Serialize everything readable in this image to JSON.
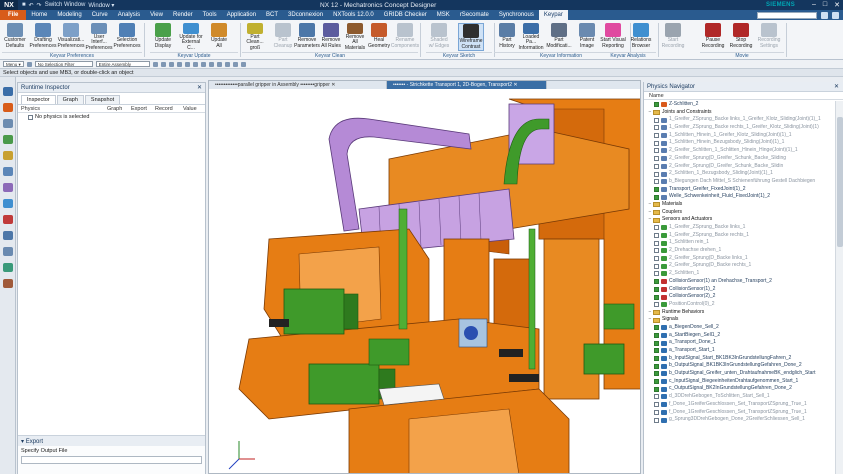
{
  "window": {
    "logo": "NX",
    "title": "NX 12 - Mechatronics Concept Designer",
    "brand": "SIEMENS",
    "quick_access": [
      "Switch Window",
      "Window ▾"
    ],
    "controls": [
      "–",
      "□",
      "✕"
    ]
  },
  "menu": {
    "tabs": [
      "File",
      "Home",
      "Modeling",
      "Curve",
      "Analysis",
      "View",
      "Render",
      "Tools",
      "Application",
      "BCT",
      "3Dconnexion",
      "NXTools 12.0.0",
      "GRIDB Checker",
      "MSK",
      "rSecomate",
      "Synchronous",
      "Keypar"
    ],
    "active": "Keypar"
  },
  "ribbon": {
    "buttons": [
      {
        "label": "Customer\nDefaults",
        "color": "#6d8fb5",
        "state": "normal"
      },
      {
        "label": "Drafting\nPreferences",
        "color": "#5b86b8",
        "state": "normal"
      },
      {
        "label": "Visualizati...\nPreferences",
        "color": "#7da0c8",
        "state": "normal"
      },
      {
        "label": "User Interf...\nPreferences",
        "color": "#6b8fb8",
        "state": "normal"
      },
      {
        "label": "Selection\nPreferences",
        "color": "#4f7fb5",
        "state": "normal"
      },
      {
        "label": "Update\nDisplay",
        "color": "#4aa04a",
        "state": "normal"
      },
      {
        "label": "Update for\nExternal C...",
        "color": "#3f8fd0",
        "state": "normal"
      },
      {
        "label": "Update\nAll",
        "color": "#d08a2a",
        "state": "normal"
      },
      {
        "label": "Part Clean...\ngroß",
        "color": "#c0b030",
        "state": "normal"
      },
      {
        "label": "Part\nCleanup",
        "color": "#b9c3ce",
        "state": "dis"
      },
      {
        "label": "Remove\nParameters",
        "color": "#4d77a8",
        "state": "normal"
      },
      {
        "label": "Remove\nAll Rules",
        "color": "#5c5c9e",
        "state": "normal"
      },
      {
        "label": "Remove\nAll Materials",
        "color": "#8d5a2e",
        "state": "normal"
      },
      {
        "label": "Heal\nGeometry",
        "color": "#c55a2a",
        "state": "normal"
      },
      {
        "label": "Rename\nComponents",
        "color": "#b9c3ce",
        "state": "dis"
      },
      {
        "label": "Shaded\nw/ Edges",
        "color": "#b9c3ce",
        "state": "dis"
      },
      {
        "label": "Wireframe\nContrast",
        "color": "#2f2f2f",
        "state": "sel"
      },
      {
        "label": "Part\nHistory",
        "color": "#5a7da6",
        "state": "normal"
      },
      {
        "label": "Loaded Pa...\nInformation",
        "color": "#3b6ea8",
        "state": "normal"
      },
      {
        "label": "Part\nModificati...",
        "color": "#5f6f86",
        "state": "normal"
      },
      {
        "label": "Patent\nImage",
        "color": "#6a8ab0",
        "state": "normal"
      },
      {
        "label": "Start Visual\nReporting",
        "color": "#e04aa0",
        "state": "normal"
      },
      {
        "label": "Relations\nBrowser",
        "color": "#3f8fd0",
        "state": "normal"
      },
      {
        "label": "Start\nRecording",
        "color": "#9aa4af",
        "state": "dis"
      },
      {
        "label": "Pause\nRecording",
        "color": "#b02828",
        "state": "normal"
      },
      {
        "label": "Stop\nRecording",
        "color": "#b02828",
        "state": "normal"
      },
      {
        "label": "Recording\nSettings",
        "color": "#b9c3ce",
        "state": "dis"
      }
    ],
    "groups": [
      "Keyvar Preferences",
      "Keyvar Update",
      "Keyvar Clean",
      "Keyvar Sketch",
      "Keyvar Information",
      "Keyvar Analysis",
      "Movie"
    ]
  },
  "toolbar2": {
    "menu_label": "Menu ▾",
    "filter": "No Selection Filter",
    "scope": "Entire Assembly"
  },
  "status_line": "Select objects and use MB3, or double-click an object",
  "inspector": {
    "title": "Runtime Inspector",
    "tabs": [
      "Inspector",
      "Graph",
      "Snapshot"
    ],
    "columns": [
      "Physics",
      "Graph",
      "Export",
      "Record",
      "Value"
    ],
    "empty_row": "No physics is selected",
    "export_title": "Export",
    "export_label": "Specify Output File"
  },
  "graphics": {
    "tabs": [
      "•••••••••••••parallel gripper in Assembly ••••••••gripper ✕",
      "••••••• - Strichkette Transport 1, 2D-Bogen, Transport2 ✕"
    ]
  },
  "navigator": {
    "title": "Physics Navigator",
    "column": "Name",
    "rows": [
      {
        "indent": 1,
        "type": "item",
        "check": true,
        "icon": "#d95a1c",
        "text": "Z-Schlitten_2",
        "tone": "normal"
      },
      {
        "indent": 0,
        "type": "folder",
        "text": "Joints and Constraints",
        "tone": "strong"
      },
      {
        "indent": 1,
        "type": "item",
        "check": false,
        "icon": "#5a7db0",
        "text": "1_Greifer_ZSprung_Backe links_1_Greifer_Klotz_Sliding(Joint)(1)_1",
        "tone": "grey"
      },
      {
        "indent": 1,
        "type": "item",
        "check": false,
        "icon": "#5a7db0",
        "text": "1_Greifer_ZSprung_Backe rechts_1_Greifer_Klotz_Sliding(Joint)(1)",
        "tone": "grey"
      },
      {
        "indent": 1,
        "type": "item",
        "check": false,
        "icon": "#5a7db0",
        "text": "1_Schlitten_Hinein_1_Greifer_Klotz_Sliding(Joint)(1)_1",
        "tone": "grey"
      },
      {
        "indent": 1,
        "type": "item",
        "check": false,
        "icon": "#5a7db0",
        "text": "1_Schlitten_Hinein_Bezugsbody_Sliding(Joint)(1)_1",
        "tone": "grey"
      },
      {
        "indent": 1,
        "type": "item",
        "check": false,
        "icon": "#5a7db0",
        "text": "2_Greifer_Schlitten_1_Schlitten_Hinein_Hinge(Joint)(1)_1",
        "tone": "grey"
      },
      {
        "indent": 1,
        "type": "item",
        "check": false,
        "icon": "#5a7db0",
        "text": "2_Greifer_Sprung(D_Greifer_Schunk_Backe_Sliding",
        "tone": "grey"
      },
      {
        "indent": 1,
        "type": "item",
        "check": false,
        "icon": "#5a7db0",
        "text": "2_Greifer_Sprung(D_Greifer_Schunk_Backe_Slidin",
        "tone": "grey"
      },
      {
        "indent": 1,
        "type": "item",
        "check": false,
        "icon": "#5a7db0",
        "text": "2_Schlitten_1_Bezugsbody_Sliding(Joint)(1)_1",
        "tone": "grey"
      },
      {
        "indent": 1,
        "type": "item",
        "check": false,
        "icon": "#5a7db0",
        "text": "b_Biegungen Dach Mittel_S Schienenführung Gestell Dachbiegen",
        "tone": "grey"
      },
      {
        "indent": 1,
        "type": "item",
        "check": true,
        "icon": "#5a7db0",
        "text": "Transport_Greifer_FixedJoint(1)_2",
        "tone": "normal"
      },
      {
        "indent": 1,
        "type": "item",
        "check": true,
        "icon": "#5a7db0",
        "text": "Welle_Schwenkeinheit_Fluid_FixedJoint(1)_2",
        "tone": "normal"
      },
      {
        "indent": 0,
        "type": "folder",
        "text": "Materials",
        "tone": "strong"
      },
      {
        "indent": 0,
        "type": "folder",
        "text": "Couplers",
        "tone": "strong"
      },
      {
        "indent": 0,
        "type": "folder",
        "text": "Sensors and Actuators",
        "tone": "strong"
      },
      {
        "indent": 1,
        "type": "item",
        "check": false,
        "icon": "#3a9a3a",
        "text": "1_Greifer_ZSprung_Backe links_1",
        "tone": "grey"
      },
      {
        "indent": 1,
        "type": "item",
        "check": false,
        "icon": "#3a9a3a",
        "text": "1_Greifer_ZSprung_Backe rechts_1",
        "tone": "grey"
      },
      {
        "indent": 1,
        "type": "item",
        "check": false,
        "icon": "#3a9a3a",
        "text": "1_Schlitten rein_1",
        "tone": "grey"
      },
      {
        "indent": 1,
        "type": "item",
        "check": false,
        "icon": "#3a9a3a",
        "text": "2_Drehachse drehen_1",
        "tone": "grey"
      },
      {
        "indent": 1,
        "type": "item",
        "check": false,
        "icon": "#3a9a3a",
        "text": "2_Greifer_Sprung(D_Backe links_1",
        "tone": "grey"
      },
      {
        "indent": 1,
        "type": "item",
        "check": false,
        "icon": "#3a9a3a",
        "text": "2_Greifer_Sprung(D_Backe rechts_1",
        "tone": "grey"
      },
      {
        "indent": 1,
        "type": "item",
        "check": false,
        "icon": "#3a9a3a",
        "text": "2_Schlitten_1",
        "tone": "grey"
      },
      {
        "indent": 1,
        "type": "item",
        "check": true,
        "icon": "#c23030",
        "text": "CollisionSensor(1) an Drehachse_Transport_2",
        "tone": "normal"
      },
      {
        "indent": 1,
        "type": "item",
        "check": true,
        "icon": "#c23030",
        "text": "CollisionSensor(1)_2",
        "tone": "normal"
      },
      {
        "indent": 1,
        "type": "item",
        "check": true,
        "icon": "#c23030",
        "text": "CollisionSensor(2)_2",
        "tone": "normal"
      },
      {
        "indent": 1,
        "type": "item",
        "check": false,
        "icon": "#3a9a3a",
        "text": "PositionControl(0)_2",
        "tone": "grey"
      },
      {
        "indent": 0,
        "type": "folder",
        "text": "Runtime Behaviors",
        "tone": "strong"
      },
      {
        "indent": 0,
        "type": "folder",
        "text": "Signals",
        "tone": "strong"
      },
      {
        "indent": 1,
        "type": "item",
        "check": true,
        "icon": "#2f6fb0",
        "text": "a_BiegenDone_Sell_2",
        "tone": "normal"
      },
      {
        "indent": 1,
        "type": "item",
        "check": true,
        "icon": "#2f6fb0",
        "text": "a_StartBiegen_Sell1_2",
        "tone": "normal"
      },
      {
        "indent": 1,
        "type": "item",
        "check": true,
        "icon": "#2f6fb0",
        "text": "a_Transport_Done_1",
        "tone": "normal"
      },
      {
        "indent": 1,
        "type": "item",
        "check": true,
        "icon": "#2f6fb0",
        "text": "a_Transport_Start_1",
        "tone": "normal"
      },
      {
        "indent": 1,
        "type": "item",
        "check": true,
        "icon": "#2f6fb0",
        "text": "b_InputSignal_Start_BK1BK3InGrundstellungFahren_2",
        "tone": "normal"
      },
      {
        "indent": 1,
        "type": "item",
        "check": true,
        "icon": "#2f6fb0",
        "text": "b_OutputSignal_BK1BK3InGrundstellungGefahren_Done_2",
        "tone": "normal"
      },
      {
        "indent": 1,
        "type": "item",
        "check": true,
        "icon": "#2f6fb0",
        "text": "b_OutputSignal_Greifer_unten_DrahtaufnahmeBK_endglich_Start",
        "tone": "normal"
      },
      {
        "indent": 1,
        "type": "item",
        "check": true,
        "icon": "#2f6fb0",
        "text": "c_InputSignal_BiegeeinheitenDrahtaufgenommen_Start_1",
        "tone": "normal"
      },
      {
        "indent": 1,
        "type": "item",
        "check": true,
        "icon": "#2f6fb0",
        "text": "c_OutputSignal_BK2InGrundstellungGefahren_Done_2",
        "tone": "normal"
      },
      {
        "indent": 1,
        "type": "item",
        "check": false,
        "icon": "#2f6fb0",
        "text": "d_3DDrehGebogen_ToSchlitten_Start_Sell_1",
        "tone": "grey"
      },
      {
        "indent": 1,
        "type": "item",
        "check": false,
        "icon": "#2f6fb0",
        "text": "f_Done_1GreiferGeschlossen_Set_TransportZSprung_True_1",
        "tone": "grey"
      },
      {
        "indent": 1,
        "type": "item",
        "check": false,
        "icon": "#2f6fb0",
        "text": "f_Done_1GreiferGeschlossen_Set_TransportZSprung_True_1",
        "tone": "grey"
      },
      {
        "indent": 1,
        "type": "item",
        "check": false,
        "icon": "#2f6fb0",
        "text": "g_Sprung3DDrehGebogen_Done_2GreiferSchliessen_Sell_1",
        "tone": "grey"
      }
    ]
  },
  "colors": {
    "accent": "#2a5b8f",
    "file_tab": "#d85c1a",
    "orange_part": "#e67d14",
    "green_part": "#3f9a2a",
    "violet_part": "#b58ad6"
  }
}
